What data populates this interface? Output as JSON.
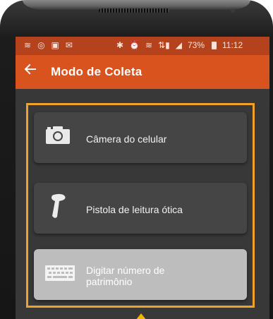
{
  "status_bar": {
    "battery": "73%",
    "time": "11:12"
  },
  "app_bar": {
    "title": "Modo de Coleta",
    "back_icon": "arrow-left-icon"
  },
  "options": [
    {
      "label": "Câmera do celular",
      "icon": "camera-icon"
    },
    {
      "label": "Pistola de leitura ótica",
      "icon": "barcode-scanner-gun-icon"
    },
    {
      "label_line1": "Digitar número de",
      "label_line2": "patrimônio",
      "icon": "keyboard-icon",
      "selected": true
    }
  ],
  "colors": {
    "app_bar": "#d9531e",
    "status_bar": "#b4421c",
    "highlight_border": "#f0a128",
    "card": "#454545",
    "card_selected": "#bdbdbd"
  }
}
